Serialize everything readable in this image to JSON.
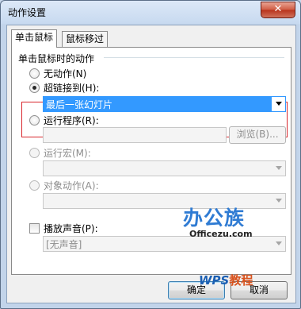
{
  "window": {
    "title": "动作设置",
    "close_label": "✕"
  },
  "tabs": [
    {
      "label": "单击鼠标",
      "active": true
    },
    {
      "label": "鼠标移过",
      "active": false
    }
  ],
  "group": {
    "label": "单击鼠标时的动作"
  },
  "options": {
    "none": {
      "label": "无动作(N)",
      "checked": false
    },
    "hyperlink": {
      "label": "超链接到(H):",
      "checked": true,
      "value": "最后一张幻灯片"
    },
    "run_program": {
      "label": "运行程序(R):",
      "checked": false,
      "value": "",
      "browse_label": "浏览(B)..."
    },
    "run_macro": {
      "label": "运行宏(M):",
      "checked": false,
      "value": ""
    },
    "object_action": {
      "label": "对象动作(A):",
      "checked": false,
      "value": ""
    }
  },
  "sound": {
    "label": "播放声音(P):",
    "checked": false,
    "value": "[无声音]"
  },
  "buttons": {
    "ok": "确定",
    "cancel": "取消"
  },
  "watermark": {
    "logo": "办公族",
    "site": "Officezu.com",
    "wps": "WPS",
    "tutorial": "教程"
  }
}
